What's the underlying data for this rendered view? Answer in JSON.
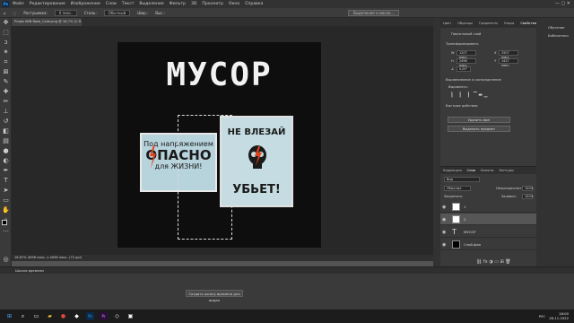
{
  "app": {
    "logo": "Ps",
    "menu": [
      "Файл",
      "Редактирование",
      "Изображение",
      "Слои",
      "Текст",
      "Выделение",
      "Фильтр",
      "3D",
      "Просмотр",
      "Окно",
      "Справка"
    ]
  },
  "options_bar": {
    "feather_label": "Растушевка:",
    "feather_value": "0 пикс.",
    "style_label": "Стиль:",
    "style_value": "Обычный",
    "width_label": "Шир.:",
    "height_label": "Выс.:",
    "select_mask_button": "Выделение и маска..."
  },
  "document": {
    "tab_title": "Propis WIN Base_Color.png @ 16,7% (С.Я.В/8) *",
    "status": "16,67%     4096 пикс. x 4096 пикс. (72 ppi)"
  },
  "artwork": {
    "title": "МУСОР",
    "sign1": {
      "line1": "Под напряжением",
      "line2": "ОПАСНО",
      "line3": "для ЖИЗНИ!"
    },
    "sign2": {
      "top": "НЕ ВЛЕЗАЙ",
      "bottom": "УБЬЕТ!"
    }
  },
  "timeline": {
    "title": "Шкала времени",
    "create_button": "Создать шкалу времени для видео"
  },
  "properties_panel": {
    "tabs": [
      "Цвет",
      "Образцы",
      "Градиенты",
      "Узоры",
      "Свойства"
    ],
    "active_tab": "Свойства",
    "pixel_layer": "Пиксельный слой",
    "transform_header": "Трансформировать",
    "w_value": "1207 пикс.",
    "x_value": "2507 пикс.",
    "h_value": "2496 пикс.",
    "y_value": "1427 пикс.",
    "angle_value": "0,00°",
    "align_header": "Выравнивание и распределение",
    "align_label": "Выровнять:",
    "quick_actions_header": "Быстрые действия",
    "remove_bg_button": "Удалить фон",
    "select_subject_button": "Выделить предмет"
  },
  "layers_panel": {
    "tabs": [
      "Коррекция",
      "Слои",
      "Каналы",
      "Контуры"
    ],
    "active_tab": "Слои",
    "search_value": "Вид",
    "blend_mode": "Обычные",
    "opacity_label": "Непрозрачность:",
    "opacity_value": "100%",
    "lock_label": "Закрепить:",
    "fill_label": "Заливка:",
    "fill_value": "100%",
    "layers": [
      {
        "name": "1",
        "type": "pixel"
      },
      {
        "name": "2",
        "type": "pixel"
      },
      {
        "name": "МУСОР",
        "type": "text"
      },
      {
        "name": "Слой-фон",
        "type": "background"
      }
    ]
  },
  "right_column": {
    "items": [
      "Обучение",
      "Библиотеки"
    ]
  },
  "taskbar": {
    "lang": "РУС",
    "time": "18:00",
    "date": "26.11.2022"
  },
  "colors": {
    "accent_ps": "#31a8ff",
    "sign_red": "#e0421a"
  }
}
